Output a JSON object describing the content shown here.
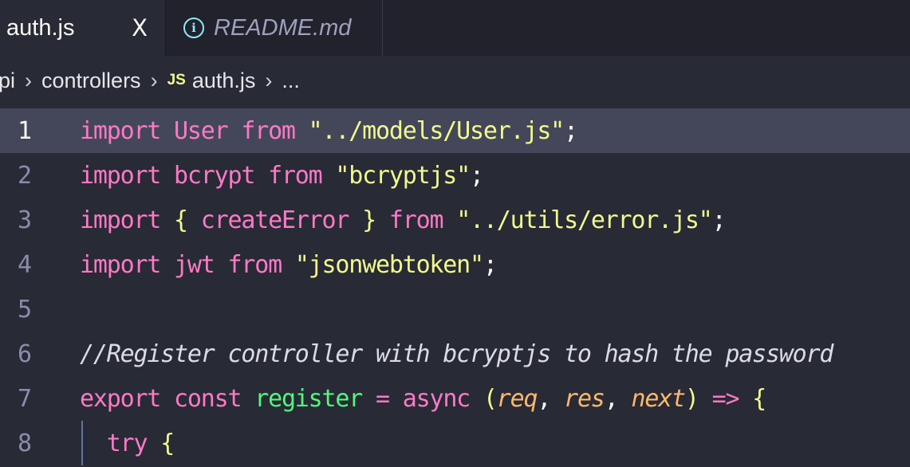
{
  "tabs": [
    {
      "label": "auth.js",
      "close": "X",
      "active": true
    },
    {
      "label": "README.md",
      "icon": "info-icon",
      "active": false
    }
  ],
  "breadcrumb": {
    "lead": "pi",
    "folder": "controllers",
    "file_badge": "JS",
    "file": "auth.js",
    "trail": "...",
    "sep": "›"
  },
  "colors": {
    "background": "#282a36",
    "keyword": "#ff79c6",
    "string": "#f1fa8c",
    "function": "#50fa7b",
    "param": "#ffb86c",
    "line_highlight": "#44475a"
  },
  "lines": [
    {
      "num": "1",
      "tokens": [
        "import",
        " User ",
        "from",
        " ",
        "\"../models/User.js\"",
        ";"
      ]
    },
    {
      "num": "2",
      "tokens": [
        "import",
        " bcrypt ",
        "from",
        " ",
        "\"bcryptjs\"",
        ";"
      ]
    },
    {
      "num": "3",
      "tokens": [
        "import",
        " ",
        "{",
        " createError ",
        "}",
        " ",
        "from",
        " ",
        "\"../utils/error.js\"",
        ";"
      ]
    },
    {
      "num": "4",
      "tokens": [
        "import",
        " jwt ",
        "from",
        " ",
        "\"jsonwebtoken\"",
        ";"
      ]
    },
    {
      "num": "5",
      "tokens": []
    },
    {
      "num": "6",
      "tokens": [
        "//Register controller with bcryptjs to hash the password"
      ]
    },
    {
      "num": "7",
      "tokens": [
        "export",
        " ",
        "const",
        " register ",
        "=",
        " ",
        "async",
        " ",
        "(",
        "req",
        ", ",
        "res",
        ", ",
        "next",
        ")",
        " ",
        "=>",
        " ",
        "{"
      ]
    },
    {
      "num": "8",
      "tokens": [
        "  ",
        "try",
        " ",
        "{"
      ]
    }
  ]
}
